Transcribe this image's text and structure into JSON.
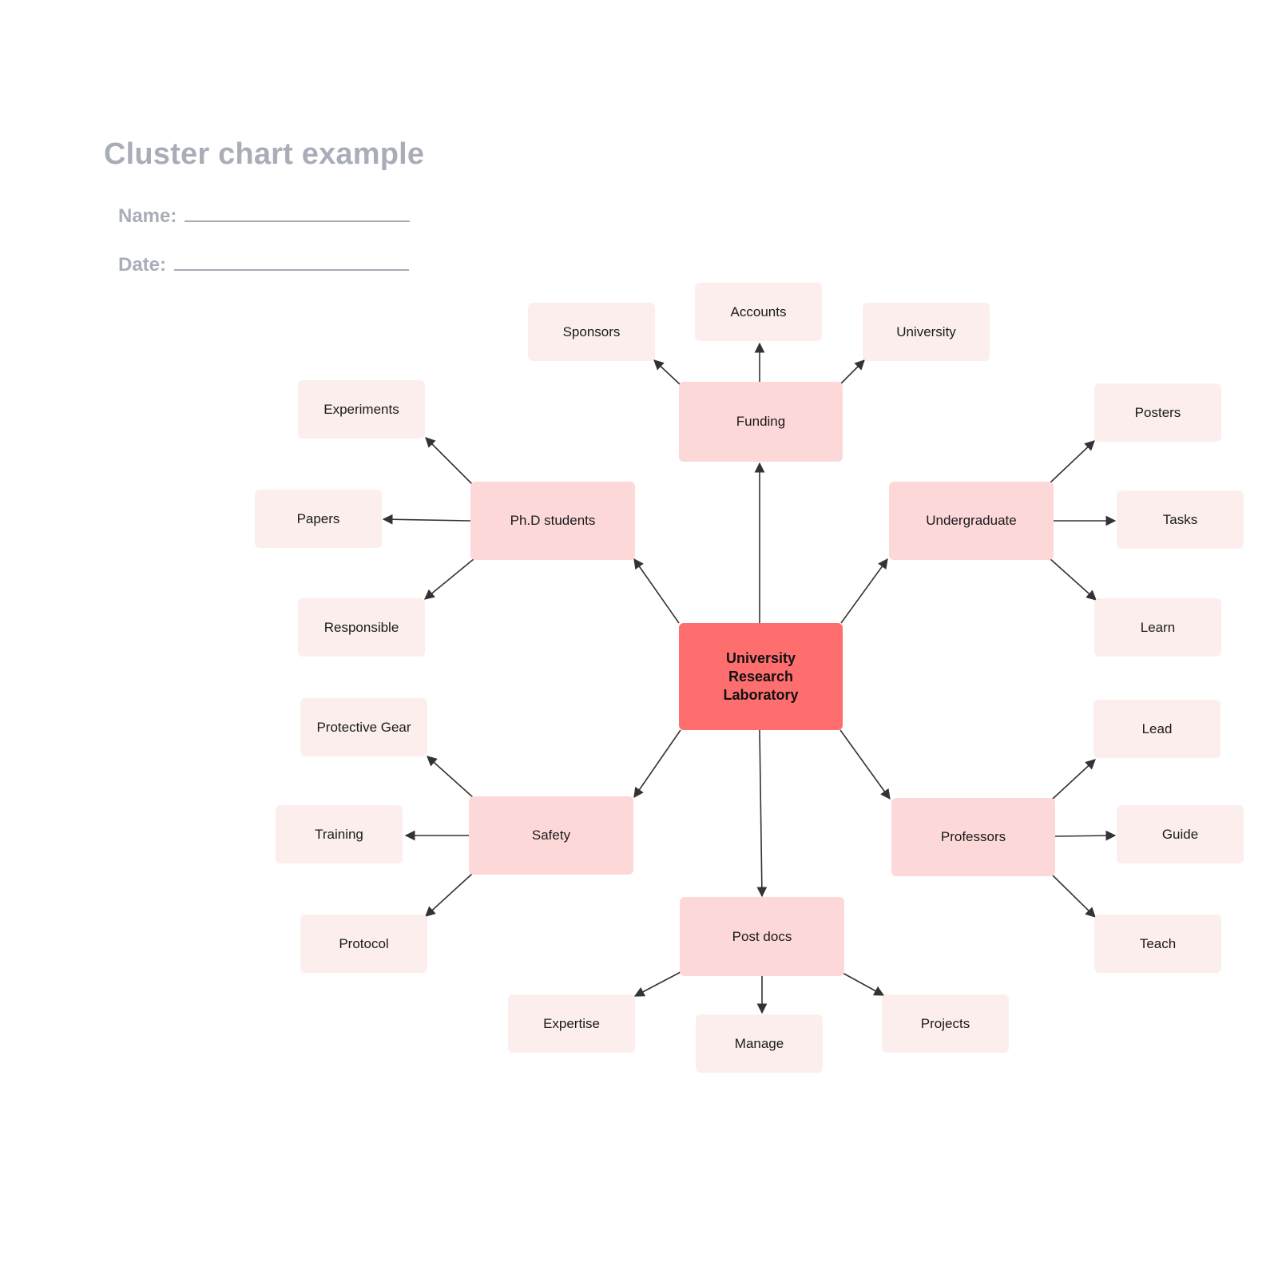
{
  "header": {
    "title": "Cluster chart example",
    "name_label": "Name:",
    "date_label": "Date:"
  },
  "colors": {
    "root": "#fe6e6e",
    "branch": "#fdd8d9",
    "leaf": "#fdeeee",
    "edge": "#333333",
    "header_text": "#a8adb7"
  },
  "diagram": {
    "root": {
      "id": "root",
      "label": "University Research Laboratory"
    },
    "branches": [
      {
        "id": "funding",
        "label": "Funding",
        "children": [
          {
            "id": "sponsors",
            "label": "Sponsors"
          },
          {
            "id": "accounts",
            "label": "Accounts"
          },
          {
            "id": "university",
            "label": "University"
          }
        ]
      },
      {
        "id": "phd",
        "label": "Ph.D students",
        "children": [
          {
            "id": "experiments",
            "label": "Experiments"
          },
          {
            "id": "papers",
            "label": "Papers"
          },
          {
            "id": "responsible",
            "label": "Responsible"
          }
        ]
      },
      {
        "id": "undergrad",
        "label": "Undergraduate",
        "children": [
          {
            "id": "posters",
            "label": "Posters"
          },
          {
            "id": "tasks",
            "label": "Tasks"
          },
          {
            "id": "learn",
            "label": "Learn"
          }
        ]
      },
      {
        "id": "safety",
        "label": "Safety",
        "children": [
          {
            "id": "protective",
            "label": "Protective Gear"
          },
          {
            "id": "training",
            "label": "Training"
          },
          {
            "id": "protocol",
            "label": "Protocol"
          }
        ]
      },
      {
        "id": "professors",
        "label": "Professors",
        "children": [
          {
            "id": "lead",
            "label": "Lead"
          },
          {
            "id": "guide",
            "label": "Guide"
          },
          {
            "id": "teach",
            "label": "Teach"
          }
        ]
      },
      {
        "id": "postdocs",
        "label": "Post docs",
        "children": [
          {
            "id": "expertise",
            "label": "Expertise"
          },
          {
            "id": "manage",
            "label": "Manage"
          },
          {
            "id": "projects",
            "label": "Projects"
          }
        ]
      }
    ]
  }
}
